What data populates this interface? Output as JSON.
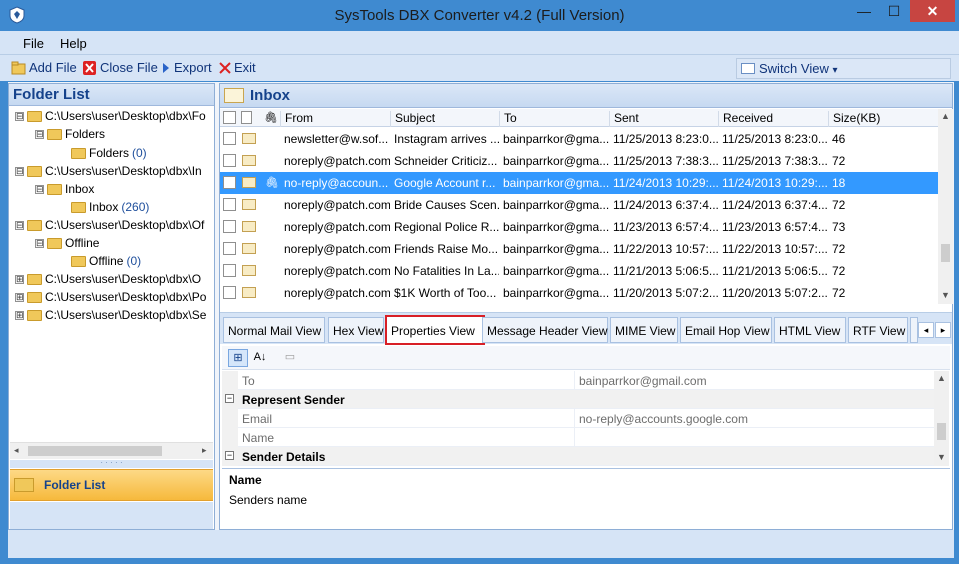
{
  "window": {
    "title": "SysTools DBX Converter v4.2 (Full Version)",
    "min_glyph": "—",
    "max_glyph": "☐",
    "close_glyph": "✕"
  },
  "menu": {
    "file": "File",
    "help": "Help"
  },
  "toolbar": {
    "add_file": "Add File",
    "close_file": "Close File",
    "export": "Export",
    "exit": "Exit",
    "switch_view": "Switch View",
    "switch_view_caret": "▾"
  },
  "folder_panel": {
    "title": "Folder List",
    "tree": [
      {
        "label": "C:\\Users\\user\\Desktop\\dbx\\Fo",
        "expander": "⊟"
      },
      {
        "label": "Folders",
        "expander": "⊟"
      },
      {
        "label": "Folders",
        "count": "(0)"
      },
      {
        "label": "C:\\Users\\user\\Desktop\\dbx\\In",
        "expander": "⊟"
      },
      {
        "label": "Inbox",
        "expander": "⊟"
      },
      {
        "label": "Inbox",
        "count": "(260)"
      },
      {
        "label": "C:\\Users\\user\\Desktop\\dbx\\Of",
        "expander": "⊟"
      },
      {
        "label": "Offline",
        "expander": "⊟"
      },
      {
        "label": "Offline",
        "count": "(0)"
      },
      {
        "label": "C:\\Users\\user\\Desktop\\dbx\\O",
        "expander": "⊞"
      },
      {
        "label": "C:\\Users\\user\\Desktop\\dbx\\Po",
        "expander": "⊞"
      },
      {
        "label": "C:\\Users\\user\\Desktop\\dbx\\Se",
        "expander": "⊞"
      }
    ],
    "bottom_button": "Folder List"
  },
  "mail_list": {
    "folder_title": "Inbox",
    "columns": [
      "From",
      "Subject",
      "To",
      "Sent",
      "Received",
      "Size(KB)"
    ],
    "rows": [
      {
        "from": "newsletter@w.sof...",
        "subject": "Instagram arrives ...",
        "to": "bainparrkor@gma...",
        "sent": "11/25/2013 8:23:0...",
        "received": "11/25/2013 8:23:0...",
        "size": "46",
        "selected": false,
        "attachment": ""
      },
      {
        "from": "noreply@patch.com",
        "subject": "Schneider Criticiz...",
        "to": "bainparrkor@gma...",
        "sent": "11/25/2013 7:38:3...",
        "received": "11/25/2013 7:38:3...",
        "size": "72",
        "selected": false,
        "attachment": ""
      },
      {
        "from": "no-reply@accoun...",
        "subject": "Google Account r...",
        "to": "bainparrkor@gma...",
        "sent": "11/24/2013 10:29:...",
        "received": "11/24/2013 10:29:...",
        "size": "18",
        "selected": true,
        "attachment": "🖇"
      },
      {
        "from": "noreply@patch.com",
        "subject": "Bride Causes Scen...",
        "to": "bainparrkor@gma...",
        "sent": "11/24/2013 6:37:4...",
        "received": "11/24/2013 6:37:4...",
        "size": "72",
        "selected": false,
        "attachment": ""
      },
      {
        "from": "noreply@patch.com",
        "subject": "Regional Police R...",
        "to": "bainparrkor@gma...",
        "sent": "11/23/2013 6:57:4...",
        "received": "11/23/2013 6:57:4...",
        "size": "73",
        "selected": false,
        "attachment": ""
      },
      {
        "from": "noreply@patch.com",
        "subject": "Friends Raise Mo...",
        "to": "bainparrkor@gma...",
        "sent": "11/22/2013 10:57:...",
        "received": "11/22/2013 10:57:...",
        "size": "72",
        "selected": false,
        "attachment": ""
      },
      {
        "from": "noreply@patch.com",
        "subject": "No Fatalities In La...",
        "to": "bainparrkor@gma...",
        "sent": "11/21/2013 5:06:5...",
        "received": "11/21/2013 5:06:5...",
        "size": "72",
        "selected": false,
        "attachment": ""
      },
      {
        "from": "noreply@patch.com",
        "subject": "$1K Worth of Too...",
        "to": "bainparrkor@gma...",
        "sent": "11/20/2013 5:07:2...",
        "received": "11/20/2013 5:07:2...",
        "size": "72",
        "selected": false,
        "attachment": ""
      }
    ]
  },
  "tabs": {
    "items": [
      {
        "label": "Normal Mail View"
      },
      {
        "label": "Hex View"
      },
      {
        "label": "Properties View",
        "active": true
      },
      {
        "label": "Message Header View"
      },
      {
        "label": "MIME View"
      },
      {
        "label": "Email Hop View"
      },
      {
        "label": "HTML View"
      },
      {
        "label": "RTF View"
      }
    ],
    "nav_left": "◂",
    "nav_right": "▸"
  },
  "properties": {
    "toolbar": {
      "categorized": "⊞",
      "alphabetical": "A↓",
      "pages": "▭"
    },
    "rows": [
      {
        "key": "To",
        "value": "bainparrkor@gmail.com",
        "type": "item"
      },
      {
        "key": "Represent Sender",
        "value": "",
        "type": "category"
      },
      {
        "key": "Email",
        "value": "no-reply@accounts.google.com",
        "type": "item"
      },
      {
        "key": "Name",
        "value": "",
        "type": "item"
      },
      {
        "key": "Sender Details",
        "value": "",
        "type": "category"
      }
    ],
    "description_title": "Name",
    "description_text": "Senders name"
  }
}
